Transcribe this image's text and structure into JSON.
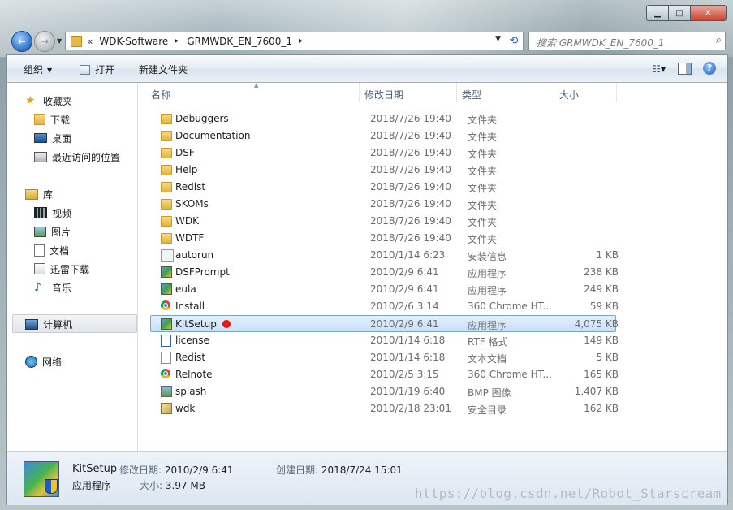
{
  "window": {
    "caption_buttons": {
      "minimize": "▁",
      "maximize": "□",
      "close": "✕"
    }
  },
  "nav_buttons": {
    "back": "←",
    "forward": "→"
  },
  "address": {
    "crumbs": [
      "WDK-Software",
      "GRMWDK_EN_7600_1"
    ],
    "overflow": "«",
    "separator": "▸"
  },
  "search": {
    "placeholder": "搜索 GRMWDK_EN_7600_1"
  },
  "toolbar": {
    "organize": "组织",
    "open": "打开",
    "new_folder": "新建文件夹"
  },
  "sidebar": {
    "favorites": {
      "label": "收藏夹",
      "items": [
        "下载",
        "桌面",
        "最近访问的位置"
      ]
    },
    "libraries": {
      "label": "库",
      "items": [
        "视频",
        "图片",
        "文档",
        "迅雷下载",
        "音乐"
      ]
    },
    "computer": "计算机",
    "network": "网络"
  },
  "columns": {
    "name": "名称",
    "modified": "修改日期",
    "type": "类型",
    "size": "大小"
  },
  "files": [
    {
      "name": "Debuggers",
      "modified": "2018/7/26 19:40",
      "type": "文件夹",
      "size": "",
      "icon": "folder-icon"
    },
    {
      "name": "Documentation",
      "modified": "2018/7/26 19:40",
      "type": "文件夹",
      "size": "",
      "icon": "folder-icon"
    },
    {
      "name": "DSF",
      "modified": "2018/7/26 19:40",
      "type": "文件夹",
      "size": "",
      "icon": "folder-icon"
    },
    {
      "name": "Help",
      "modified": "2018/7/26 19:40",
      "type": "文件夹",
      "size": "",
      "icon": "folder-icon"
    },
    {
      "name": "Redist",
      "modified": "2018/7/26 19:40",
      "type": "文件夹",
      "size": "",
      "icon": "folder-icon"
    },
    {
      "name": "SKOMs",
      "modified": "2018/7/26 19:40",
      "type": "文件夹",
      "size": "",
      "icon": "folder-icon"
    },
    {
      "name": "WDK",
      "modified": "2018/7/26 19:40",
      "type": "文件夹",
      "size": "",
      "icon": "folder-icon"
    },
    {
      "name": "WDTF",
      "modified": "2018/7/26 19:40",
      "type": "文件夹",
      "size": "",
      "icon": "folder-icon"
    },
    {
      "name": "autorun",
      "modified": "2010/1/14 6:23",
      "type": "安装信息",
      "size": "1 KB",
      "icon": "ini-file-icon"
    },
    {
      "name": "DSFPrompt",
      "modified": "2010/2/9 6:41",
      "type": "应用程序",
      "size": "238 KB",
      "icon": "app-icon"
    },
    {
      "name": "eula",
      "modified": "2010/2/9 6:41",
      "type": "应用程序",
      "size": "249 KB",
      "icon": "app-icon"
    },
    {
      "name": "Install",
      "modified": "2010/2/6 3:14",
      "type": "360 Chrome HT...",
      "size": "59 KB",
      "icon": "chrome-icon"
    },
    {
      "name": "KitSetup",
      "modified": "2010/2/9 6:41",
      "type": "应用程序",
      "size": "4,075 KB",
      "icon": "app-icon",
      "selected": true
    },
    {
      "name": "license",
      "modified": "2010/1/14 6:18",
      "type": "RTF 格式",
      "size": "149 KB",
      "icon": "rtf-file-icon"
    },
    {
      "name": "Redist",
      "modified": "2010/1/14 6:18",
      "type": "文本文档",
      "size": "5 KB",
      "icon": "text-file-icon"
    },
    {
      "name": "Relnote",
      "modified": "2010/2/5 3:15",
      "type": "360 Chrome HT...",
      "size": "165 KB",
      "icon": "chrome-icon"
    },
    {
      "name": "splash",
      "modified": "2010/1/19 6:40",
      "type": "BMP 图像",
      "size": "1,407 KB",
      "icon": "bmp-file-icon"
    },
    {
      "name": "wdk",
      "modified": "2010/2/18 23:01",
      "type": "安全目录",
      "size": "162 KB",
      "icon": "catalog-file-icon"
    }
  ],
  "details": {
    "name": "KitSetup",
    "type": "应用程序",
    "modified_label": "修改日期:",
    "modified": "2010/2/9 6:41",
    "created_label": "创建日期:",
    "created": "2018/7/24 15:01",
    "size_label": "大小:",
    "size": "3.97 MB"
  },
  "watermark": "https://blog.csdn.net/Robot_Starscream"
}
